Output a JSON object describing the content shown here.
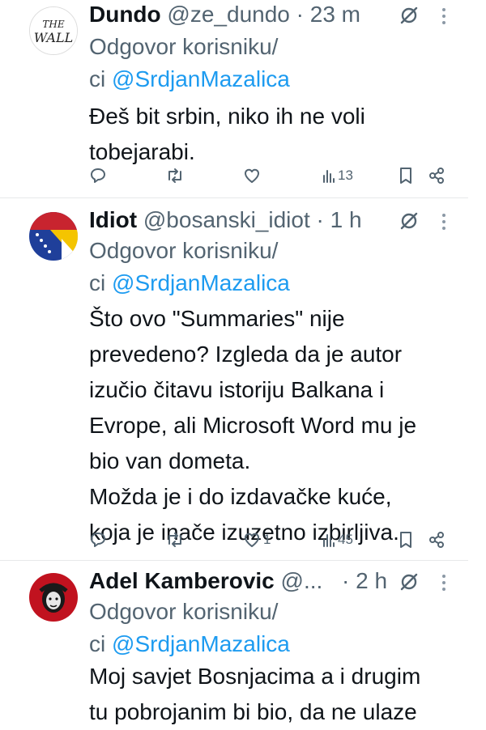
{
  "tweets": [
    {
      "name": "Dundo",
      "handle": "@ze_dundo",
      "dot": "·",
      "time": "23 m",
      "reply_prefix_line1": "Odgovor korisniku/",
      "reply_prefix_line2": "ci",
      "mention": "@SrdjanMazalica",
      "text": "Đeš bit srbin, niko ih ne voli\ntobejarabi.",
      "likes": "",
      "views": "13",
      "avatar": "the-wall-logo"
    },
    {
      "name": "Idiot",
      "handle": "@bosanski_idiot",
      "dot": "·",
      "time": "1 h",
      "reply_prefix_line1": "Odgovor korisniku/",
      "reply_prefix_line2": "ci",
      "mention": "@SrdjanMazalica",
      "text": "Što ovo \"Summaries\" nije\nprevedeno?  Izgleda da je autor\nizučio čitavu istoriju Balkana i\nEvrope, ali Microsoft Word mu je\nbio van dometa.\nMožda je i do izdavačke kuće,\nkoja je inače izuzetno izbirljiva.",
      "likes": "1",
      "views": "45",
      "avatar": "bosnia-flag"
    },
    {
      "name": "Adel Kamberovic",
      "handle": "@...",
      "dot": "·",
      "time": "2 h",
      "reply_prefix_line1": "Odgovor korisniku/",
      "reply_prefix_line2": "ci",
      "mention": "@SrdjanMazalica",
      "text": "Moj savjet Bosnjacima a i drugim\ntu pobrojanim bi bio, da ne ulaze",
      "avatar": "red-portrait"
    }
  ],
  "colors": {
    "text": "#0f1419",
    "secondary": "#536471",
    "link": "#1d9bf0",
    "divider": "#e7e9ea"
  }
}
